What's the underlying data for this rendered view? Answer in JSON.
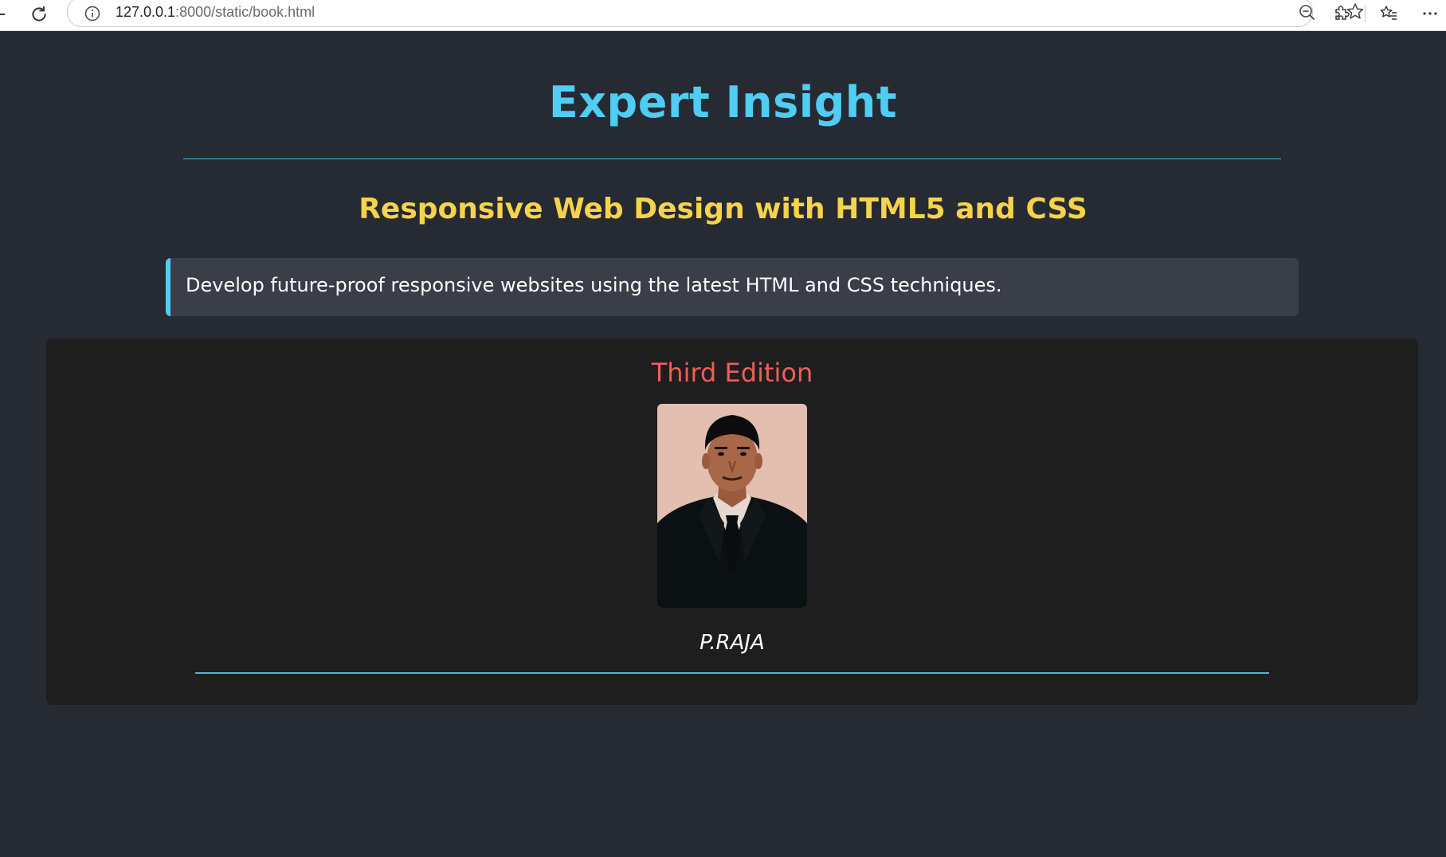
{
  "browser": {
    "url_host": "127.0.0.1",
    "url_path": ":8000/static/book.html",
    "icons": [
      "back-icon",
      "reload-icon",
      "info-icon",
      "zoom-out-icon",
      "star-icon",
      "extensions-icon",
      "favorites-icon",
      "more-icon"
    ]
  },
  "page": {
    "title": "Expert Insight",
    "book_title": "Responsive Web Design with HTML5 and CSS",
    "description": "Develop future-proof responsive websites using the latest HTML and CSS techniques.",
    "edition": "Third Edition",
    "author": "P.RAJA"
  },
  "colors": {
    "background": "#262a33",
    "title": "#4fcdf3",
    "book_title": "#f5d34b",
    "quote_bg": "#3a3e48",
    "card_bg": "#1e1e1e",
    "edition": "#ef5e55",
    "accent_rule": "#4fb6d8"
  }
}
